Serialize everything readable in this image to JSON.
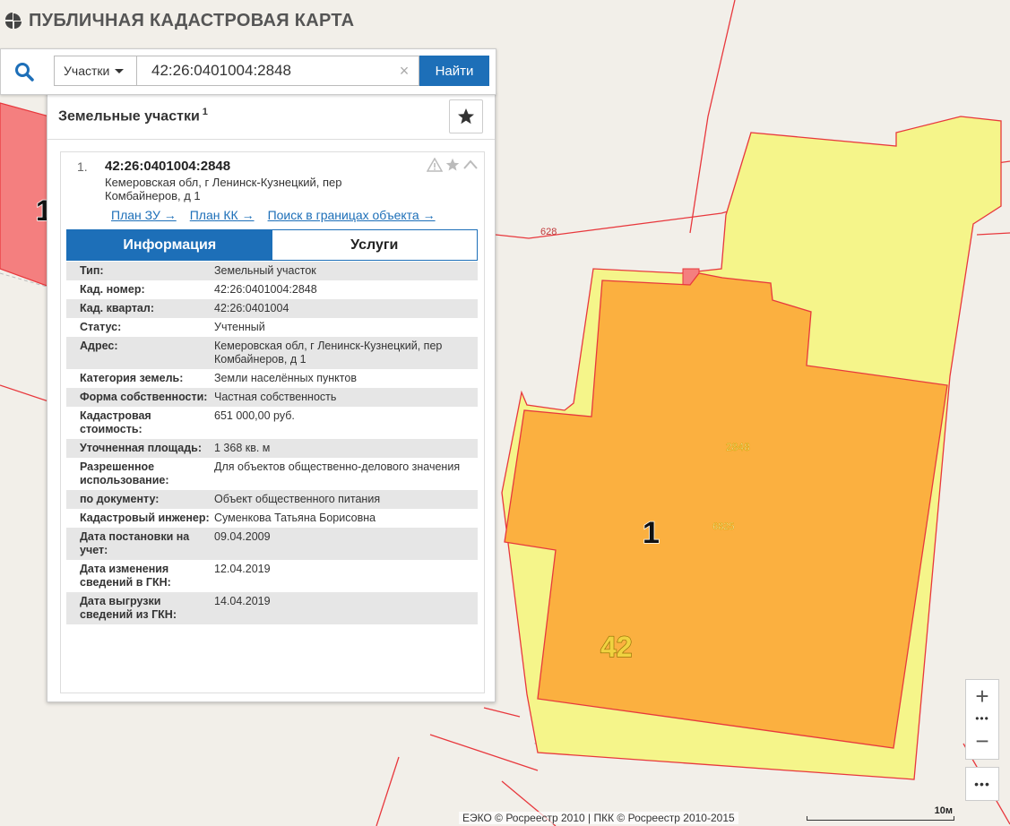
{
  "app": {
    "title": "ПУБЛИЧНАЯ КАДАСТРОВАЯ КАРТА"
  },
  "search": {
    "type_label": "Участки",
    "query": "42:26:0401004:2848",
    "clear": "×",
    "find_label": "Найти"
  },
  "results": {
    "heading": "Земельные участки",
    "count": "1",
    "item": {
      "index": "1.",
      "cadastral_number": "42:26:0401004:2848",
      "address": "Кемеровская обл, г Ленинск-Кузнецкий, пер Комбайнеров, д 1",
      "links": [
        "План ЗУ →",
        "План КК →",
        "Поиск в границах объекта →"
      ],
      "tabs": [
        "Информация",
        "Услуги"
      ],
      "info": [
        {
          "key": "Тип:",
          "value": "Земельный участок"
        },
        {
          "key": "Кад. номер:",
          "value": "42:26:0401004:2848"
        },
        {
          "key": "Кад. квартал:",
          "value": "42:26:0401004"
        },
        {
          "key": "Статус:",
          "value": "Учтенный"
        },
        {
          "key": "Адрес:",
          "value": "Кемеровская обл, г Ленинск-Кузнецкий, пер Комбайнеров, д 1"
        },
        {
          "key": "Категория земель:",
          "value": "Земли населённых пунктов"
        },
        {
          "key": "Форма собственности:",
          "value": "Частная собственность"
        },
        {
          "key": "Кадастровая стоимость:",
          "value": "651 000,00 руб."
        },
        {
          "key": "Уточненная площадь:",
          "value": "1 368 кв. м"
        },
        {
          "key": "Разрешенное использование:",
          "value": "Для объектов общественно-делового значения"
        },
        {
          "key": "по документу:",
          "value": "Объект общественного питания"
        },
        {
          "key": "Кадастровый инженер:",
          "value": "Суменкова Татьяна Борисовна"
        },
        {
          "key": "Дата постановки на учет:",
          "value": "09.04.2009"
        },
        {
          "key": "Дата изменения сведений в ГКН:",
          "value": "12.04.2019"
        },
        {
          "key": "Дата выгрузки сведений из ГКН:",
          "value": "14.04.2019"
        }
      ]
    }
  },
  "map": {
    "labels": {
      "parcel_628": "628",
      "parcel_2848": "2848",
      "parcel_6825": "6825",
      "cluster_1": "1",
      "cluster_42": "42",
      "left_cluster": "1"
    },
    "colors": {
      "selected_fill": "#fbb040",
      "parcel_fill": "#f5f58a",
      "boundary": "#e8383d",
      "left_parcel": "#f47f7f",
      "accent": "#1d6fb8"
    }
  },
  "controls": {
    "zoom_in": "+",
    "zoom_out": "−",
    "zoom_mid": "•••",
    "more": "•••"
  },
  "footer": {
    "copyright": "ЕЭКО © Росреестр 2010 | ПКК © Росреестр 2010-2015",
    "scale": "10м"
  }
}
